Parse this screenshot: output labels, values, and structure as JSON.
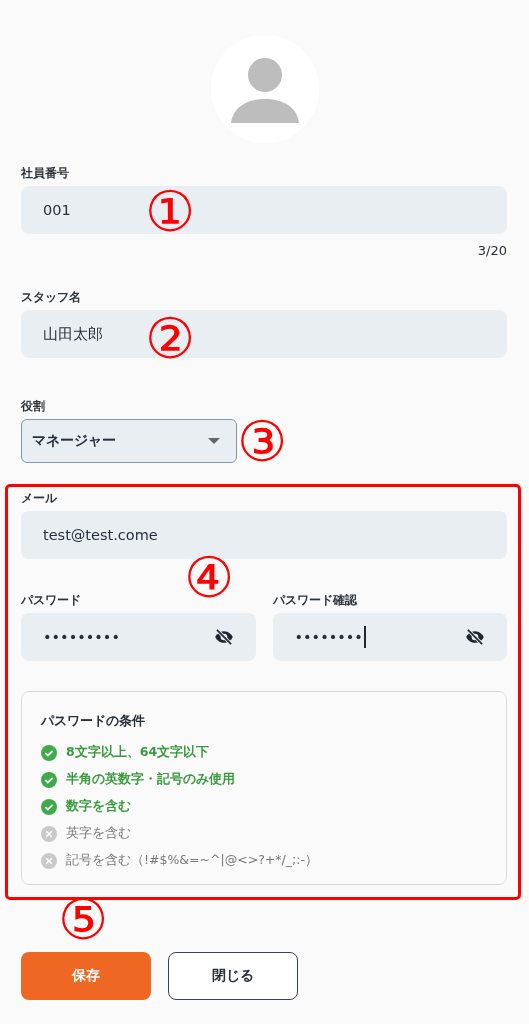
{
  "employee_number": {
    "label": "社員番号",
    "value": "001",
    "counter": "3/20"
  },
  "staff_name": {
    "label": "スタッフ名",
    "value": "山田太郎"
  },
  "role": {
    "label": "役割",
    "value": "マネージャー"
  },
  "email": {
    "label": "メール",
    "value": "test@test.come"
  },
  "password": {
    "label": "パスワード",
    "value": "•••••••••"
  },
  "password_confirm": {
    "label": "パスワード確認",
    "value": "••••••••",
    "focused": true
  },
  "conditions": {
    "title": "パスワードの条件",
    "items": [
      {
        "text": "8文字以上、64文字以下",
        "met": true
      },
      {
        "text": "半角の英数字・記号のみ使用",
        "met": true
      },
      {
        "text": "数字を含む",
        "met": true
      },
      {
        "text": "英字を含む",
        "met": false
      },
      {
        "text": "記号を含む（!#$%&=~^|@<>?+*/_;:-）",
        "met": false
      }
    ]
  },
  "buttons": [
    {
      "label": "保存",
      "kind": "primary"
    },
    {
      "label": "閉じる",
      "kind": "secondary"
    }
  ],
  "annotations": [
    "①",
    "②",
    "③",
    "④",
    "⑤"
  ]
}
